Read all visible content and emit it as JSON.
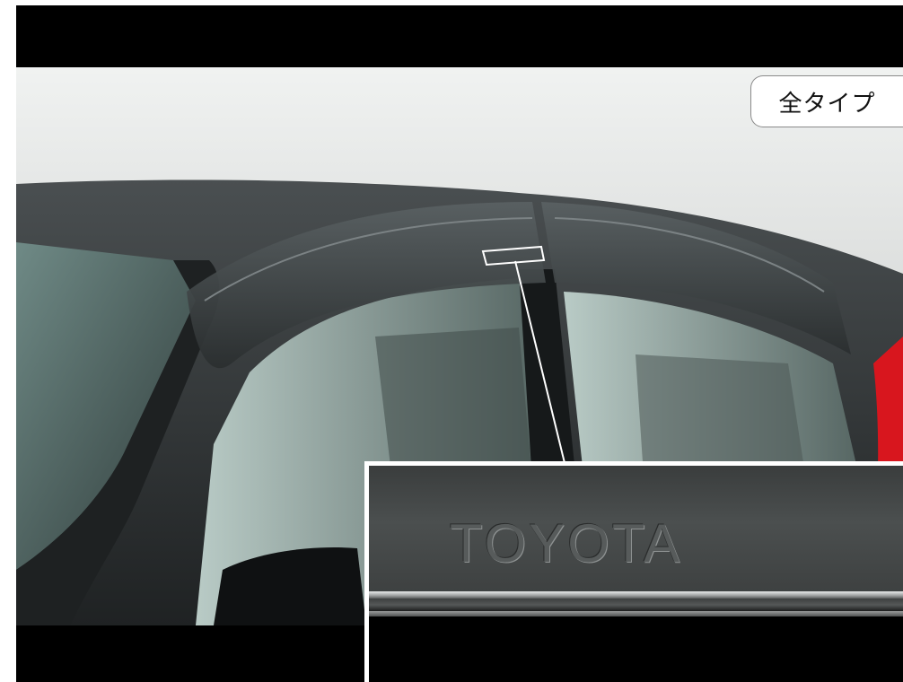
{
  "badge": {
    "label": "全タイプ"
  },
  "inset": {
    "emblem_text": "TOYOTA"
  },
  "colors": {
    "background": "#000000",
    "car_body": "#2b2e2f",
    "visor": "#3a3f41",
    "glass": "#8fa9a4",
    "tail_light": "#d8161e",
    "inset_border": "#ffffff"
  }
}
